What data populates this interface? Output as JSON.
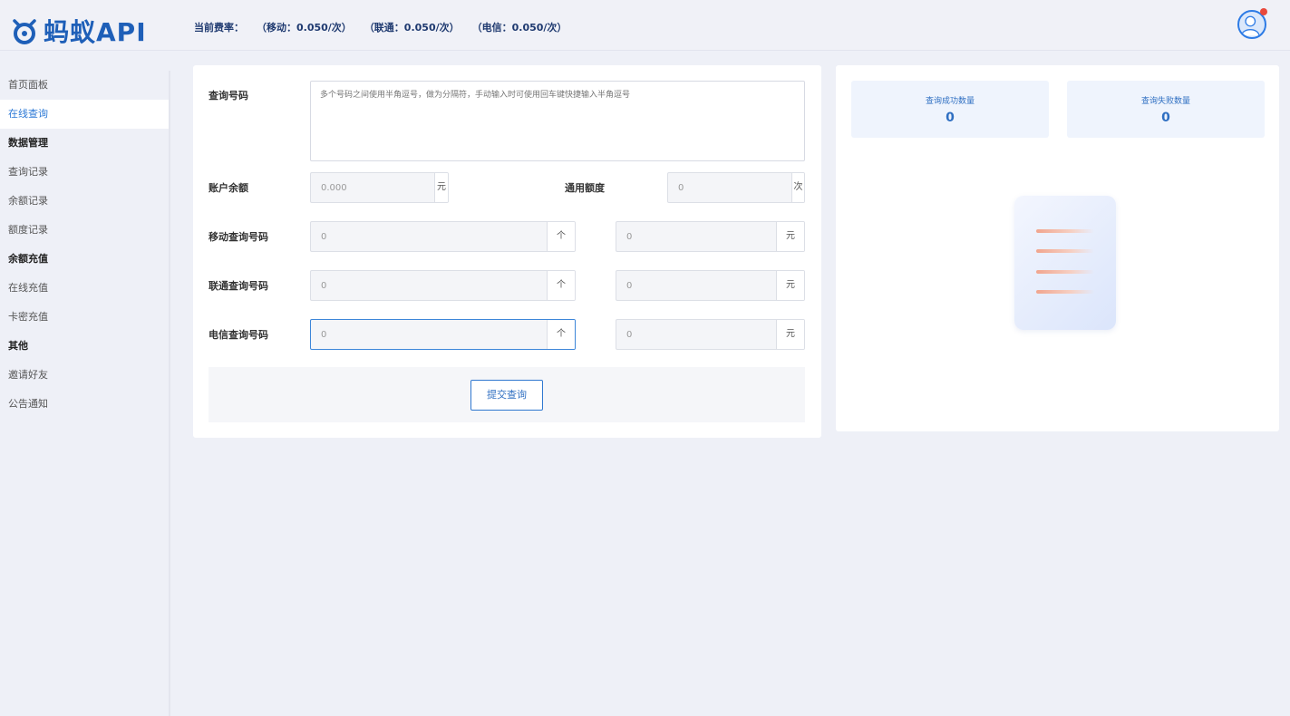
{
  "app": {
    "logo_text": "蚂蚁API",
    "brand_color": "#1e5fb8",
    "accent_color": "#2f78d0"
  },
  "header": {
    "rate_label": "当前费率：",
    "rates": [
      "（移动：0.050/次）",
      "（联通：0.050/次）",
      "（电信：0.050/次）"
    ],
    "avatar_icon": "user-avatar-icon"
  },
  "sidebar": {
    "items": [
      {
        "type": "item",
        "label": "首页面板"
      },
      {
        "type": "item",
        "label": "在线查询",
        "active": true
      },
      {
        "type": "group",
        "label": "数据管理"
      },
      {
        "type": "item",
        "label": "查询记录"
      },
      {
        "type": "item",
        "label": "余额记录"
      },
      {
        "type": "item",
        "label": "额度记录"
      },
      {
        "type": "group",
        "label": "余额充值"
      },
      {
        "type": "item",
        "label": "在线充值"
      },
      {
        "type": "item",
        "label": "卡密充值"
      },
      {
        "type": "group",
        "label": "其他"
      },
      {
        "type": "item",
        "label": "邀请好友"
      },
      {
        "type": "item",
        "label": "公告通知"
      }
    ]
  },
  "form": {
    "query_label": "查询号码",
    "query_placeholder": "多个号码之间使用半角逗号，做为分隔符，手动输入时可使用回车键快捷输入半角逗号",
    "balance_label": "账户余额",
    "balance_value": "0.000",
    "balance_unit": "元",
    "quota_label": "通用额度",
    "quota_value": "0",
    "quota_unit": "次",
    "mobile_label": "移动查询号码",
    "mobile_count": "0",
    "mobile_count_unit": "个",
    "mobile_cost": "0",
    "mobile_cost_unit": "元",
    "unicom_label": "联通查询号码",
    "unicom_count": "0",
    "unicom_count_unit": "个",
    "unicom_cost": "0",
    "unicom_cost_unit": "元",
    "telecom_label": "电信查询号码",
    "telecom_count": "0",
    "telecom_count_unit": "个",
    "telecom_cost": "0",
    "telecom_cost_unit": "元",
    "submit_label": "提交查询"
  },
  "stats": {
    "success_label": "查询成功数量",
    "success_value": "0",
    "fail_label": "查询失败数量",
    "fail_value": "0",
    "illustration_icon": "document-list-icon"
  }
}
